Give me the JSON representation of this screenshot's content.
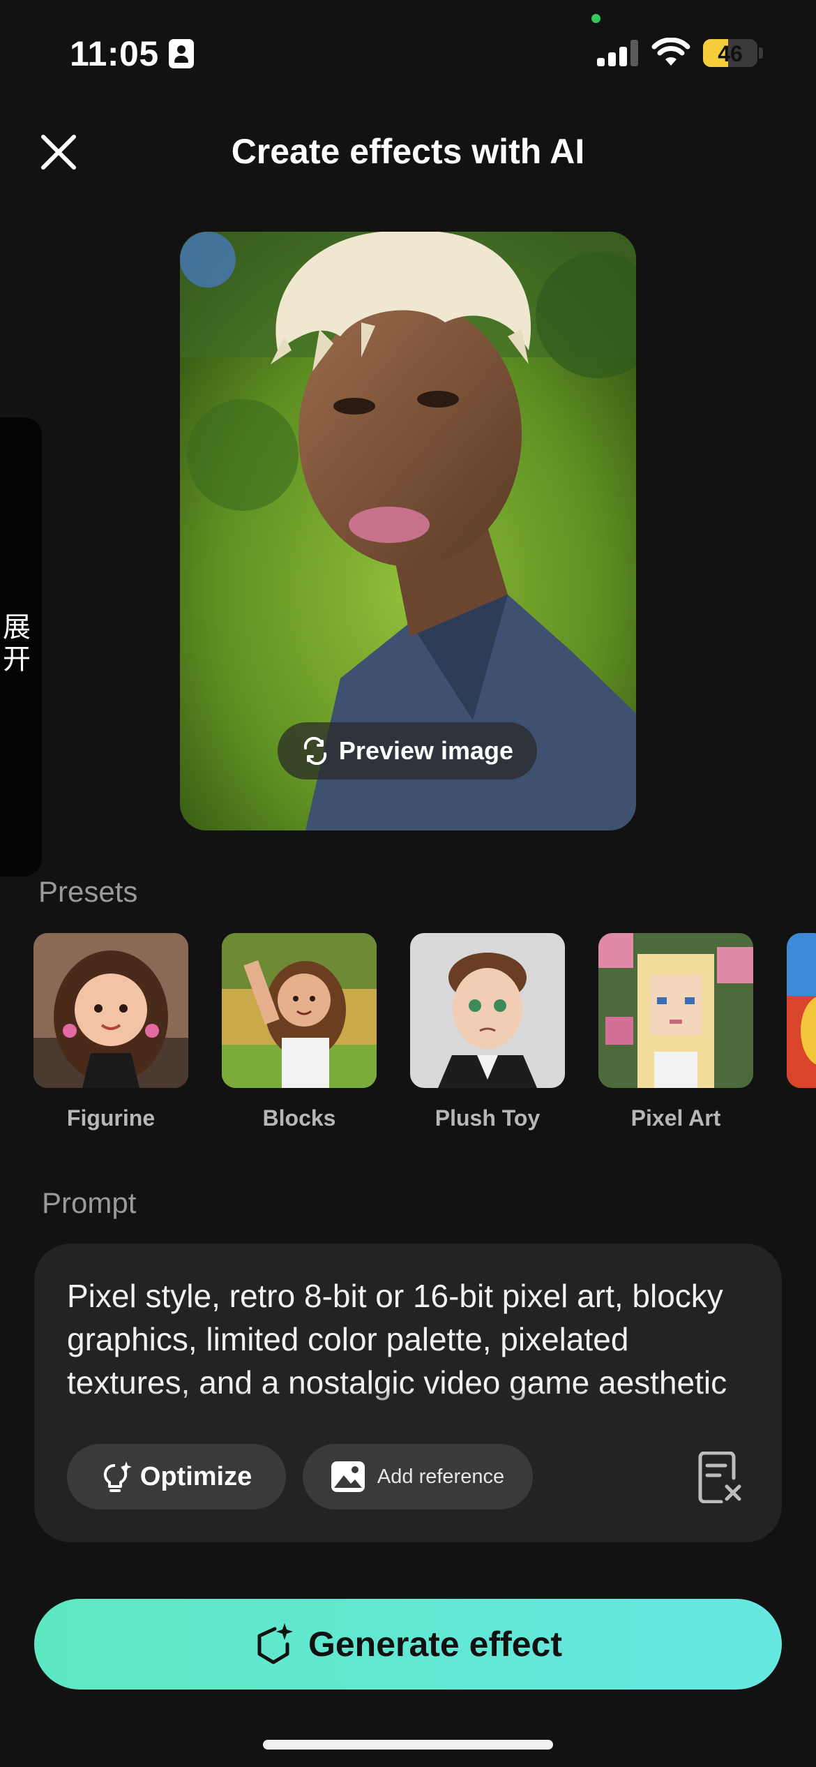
{
  "status_bar": {
    "time": "11:05",
    "battery": "46"
  },
  "header": {
    "title": "Create effects with AI"
  },
  "side_tab": {
    "label": "展开"
  },
  "preview": {
    "button_label": "Preview image"
  },
  "presets": {
    "section_label": "Presets",
    "items": [
      {
        "label": "Figurine"
      },
      {
        "label": "Blocks"
      },
      {
        "label": "Plush Toy"
      },
      {
        "label": "Pixel Art"
      }
    ]
  },
  "prompt": {
    "section_label": "Prompt",
    "text": "Pixel style, retro 8-bit or 16-bit pixel art, blocky graphics, limited color palette, pixelated textures, and a nostalgic video game aesthetic",
    "optimize_label": "Optimize",
    "reference_label": "Add reference"
  },
  "generate": {
    "label": "Generate effect"
  },
  "colors": {
    "background": "#121212",
    "accent": "#5de8c2",
    "panel": "#232323"
  }
}
